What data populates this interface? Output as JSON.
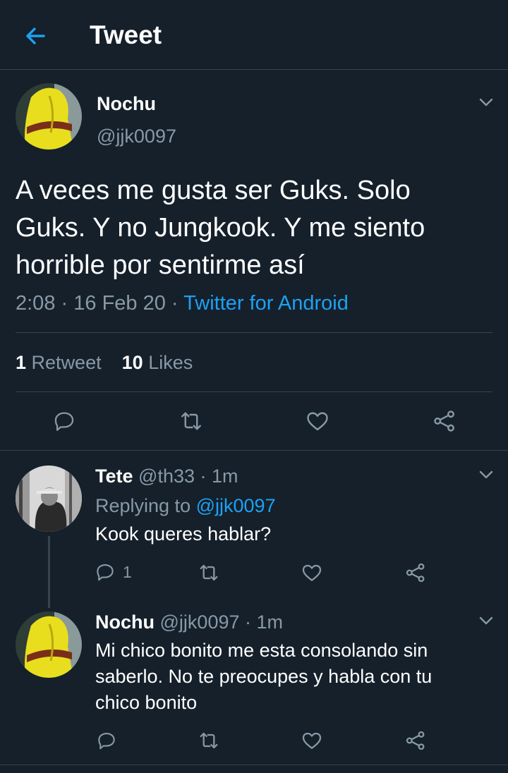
{
  "header": {
    "title": "Tweet"
  },
  "main_tweet": {
    "author_name": "Nochu",
    "author_handle": "@jjk0097",
    "text": "A veces me gusta ser Guks. Solo Guks. Y no Jungkook. Y me siento horrible por sentirme así",
    "time": "2:08",
    "date": "16 Feb 20",
    "separator": "·",
    "source": "Twitter for Android",
    "retweets_count": "1",
    "retweets_label": "Retweet",
    "likes_count": "10",
    "likes_label": "Likes"
  },
  "replies": [
    {
      "author_name": "Tete",
      "author_handle": "@th33",
      "time_sep": "·",
      "time": "1m",
      "replying_to_label": "Replying to",
      "replying_to_handle": "@jjk0097",
      "text": "Kook queres hablar?",
      "reply_count": "1"
    },
    {
      "author_name": "Nochu",
      "author_handle": "@jjk0097",
      "time_sep": "·",
      "time": "1m",
      "text": "Mi chico bonito me esta consolando sin saberlo. No te preocupes y habla con tu chico bonito"
    }
  ],
  "colors": {
    "background": "#15202b",
    "accent": "#1da1f2",
    "muted": "#8899a6",
    "divider": "#38444d"
  },
  "icons": [
    "back-arrow-icon",
    "chevron-down-icon",
    "reply-icon",
    "retweet-icon",
    "like-icon",
    "share-icon"
  ]
}
